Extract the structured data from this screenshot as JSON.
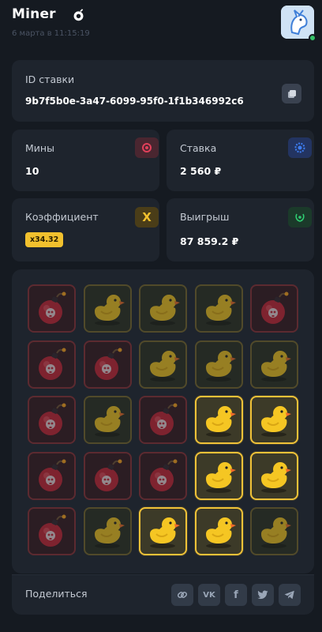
{
  "header": {
    "title": "Miner",
    "date": "6 марта в 11:15:19"
  },
  "bet_id": {
    "label": "ID ставки",
    "value": "9b7f5b0e-3a47-6099-95f0-1f1b346992c6"
  },
  "mines": {
    "label": "Мины",
    "value": "10",
    "badge_color": "#e0405a"
  },
  "stake": {
    "label": "Ставка",
    "value": "2 560 ₽",
    "badge_color": "#3d7df0"
  },
  "coefficient": {
    "label": "Коэффициент",
    "value": "x34.32",
    "badge_text": "X",
    "badge_color": "#f2c12e"
  },
  "payout": {
    "label": "Выигрыш",
    "value": "87 859.2 ₽",
    "badge_color": "#2ecc71"
  },
  "grid": [
    [
      "bomb",
      "duck-dim",
      "duck-dim",
      "duck-dim",
      "bomb"
    ],
    [
      "bomb",
      "bomb",
      "duck-dim",
      "duck-dim",
      "duck-dim"
    ],
    [
      "bomb",
      "duck-dim",
      "bomb",
      "duck-open",
      "duck-open"
    ],
    [
      "bomb",
      "bomb",
      "bomb",
      "duck-open",
      "duck-open"
    ],
    [
      "bomb",
      "duck-dim",
      "duck-open",
      "duck-open",
      "duck-dim"
    ]
  ],
  "share": {
    "label": "Поделиться",
    "buttons": [
      {
        "icon": "link-icon"
      },
      {
        "icon": "vk-icon",
        "text": "VK"
      },
      {
        "icon": "facebook-icon",
        "text": "f"
      },
      {
        "icon": "twitter-icon"
      },
      {
        "icon": "telegram-icon"
      }
    ]
  },
  "colors": {
    "background": "#151a21",
    "card": "#1e242d",
    "accent_gold": "#f2c12e",
    "online": "#35c26a"
  }
}
